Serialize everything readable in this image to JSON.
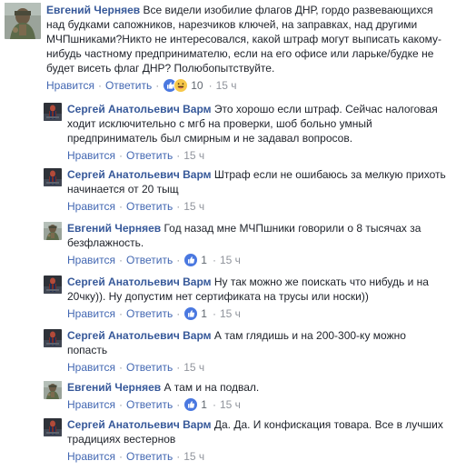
{
  "thread": {
    "actions": {
      "like": "Нравится",
      "reply": "Ответить",
      "separator": "·"
    },
    "comments": [
      {
        "author": "Евгений Черняев",
        "text": "Все видели изобилие флагов ДНР, гордо развевающихся над будками сапожников, нарезчиков ключей, на заправках, над другими МЧПшниками?Никто не интересовался, какой штраф могут выписать какому-нибудь частному предпринимателю, если на его офисе или ларьке/будке не будет висеть флаг ДНР? Полюбопытствуйте.",
        "reactions": [
          "like-icon",
          "haha-icon"
        ],
        "reaction_count": "10",
        "time": "15 ч"
      },
      {
        "author": "Сергей Анатольевич Варм",
        "text": "Это хорошо если штраф. Сейчас налоговая ходит исключительно с мгб на проверки, шоб больно умный предприниматель был смирным и не задавал вопросов.",
        "time": "15 ч"
      },
      {
        "author": "Сергей Анатольевич Варм",
        "text": "Штраф если не ошибаюсь за мелкую прихоть начинается от 20 тыщ",
        "time": "15 ч"
      },
      {
        "author": "Евгений Черняев",
        "text": "Год назад мне МЧПшники говорили о 8 тысячах за безфлажность.",
        "reactions": [
          "like-icon"
        ],
        "reaction_count": "1",
        "time": "15 ч"
      },
      {
        "author": "Сергей Анатольевич Варм",
        "text": "Ну так можно же поискать что нибудь и на 20чку)). Ну допустим нет сертификата на трусы или носки))",
        "reactions": [
          "like-icon"
        ],
        "reaction_count": "1",
        "time": "15 ч"
      },
      {
        "author": "Сергей Анатольевич Варм",
        "text": "А там глядишь и на 200-300-ку можно попасть",
        "time": "15 ч"
      },
      {
        "author": "Евгений Черняев",
        "text": "А там и на подвал.",
        "reactions": [
          "like-icon"
        ],
        "reaction_count": "1",
        "time": "15 ч"
      },
      {
        "author": "Сергей Анатольевич Варм",
        "text": "Да. Да. И конфискация товара. Все в лучших традициях вестернов",
        "time": "15 ч"
      }
    ]
  },
  "colors": {
    "author_link": "#365899",
    "action_link": "#4267b2",
    "meta_gray": "#90949c",
    "like_blue": "#4a78e0",
    "haha_yellow": "#f7c84a"
  }
}
